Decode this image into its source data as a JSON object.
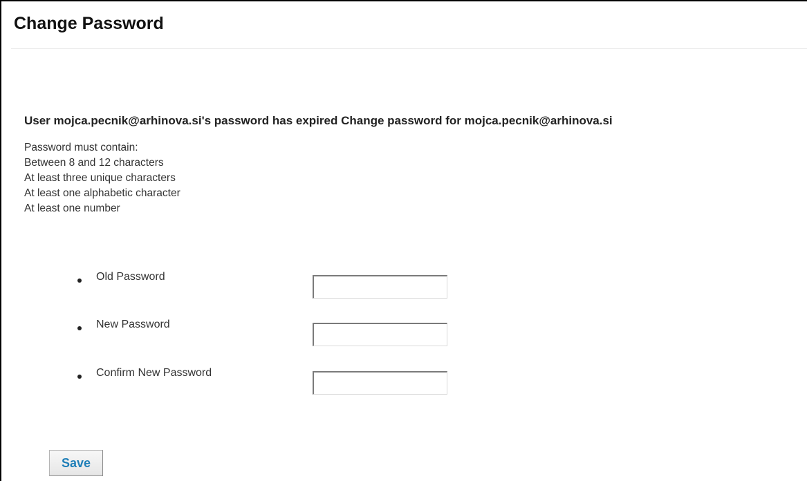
{
  "page": {
    "title": "Change Password",
    "expired_message": "User mojca.pecnik@arhinova.si's password has expired Change password for mojca.pecnik@arhinova.si"
  },
  "rules": {
    "heading": "Password must contain:",
    "items": [
      "Between 8 and 12 characters",
      "At least three unique characters",
      "At least one alphabetic character",
      "At least one number"
    ]
  },
  "form": {
    "fields": [
      {
        "label": "Old Password",
        "value": ""
      },
      {
        "label": "New Password",
        "value": ""
      },
      {
        "label": "Confirm New Password",
        "value": ""
      }
    ],
    "save_label": "Save"
  },
  "colors": {
    "save_text": "#1f7fb8"
  }
}
